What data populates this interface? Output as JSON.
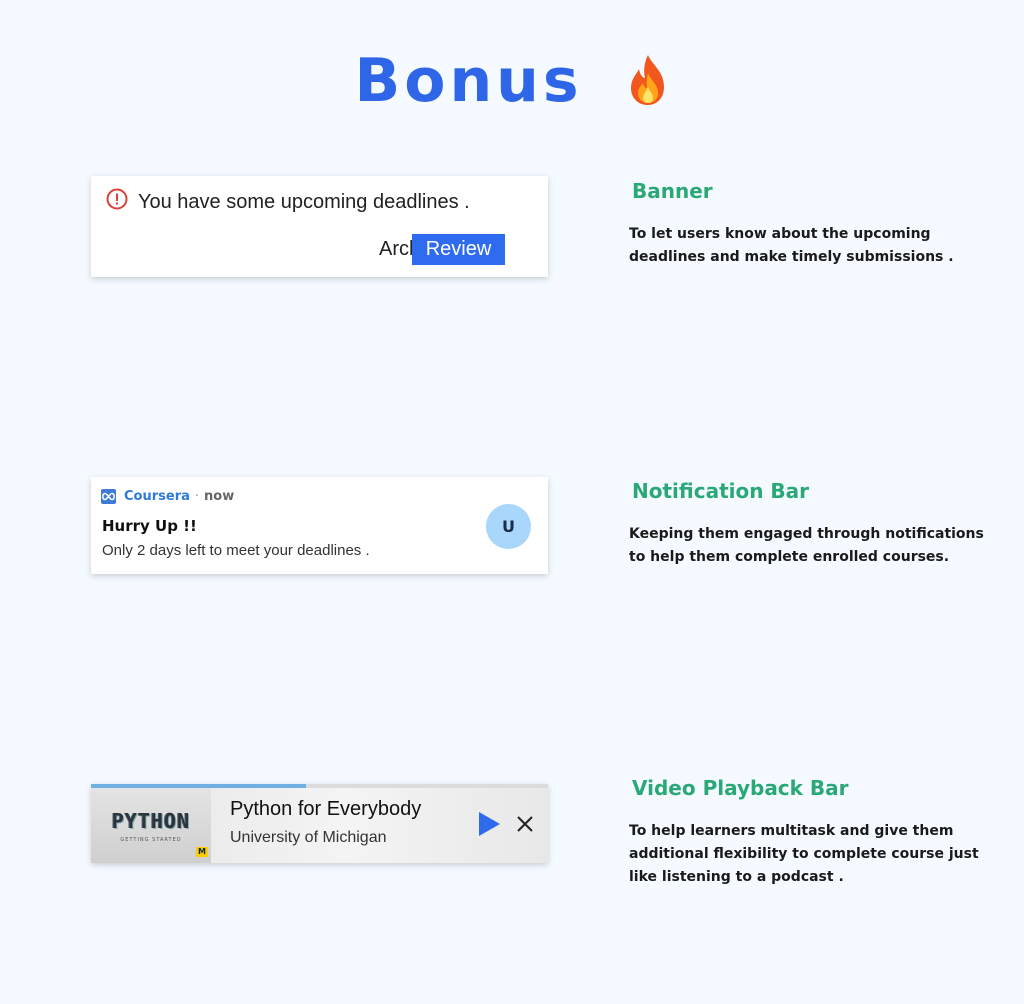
{
  "page": {
    "title": "Bonus",
    "accent": "#2f66e8",
    "heading_color": "#2aa876"
  },
  "banner": {
    "message": "You have some upcoming deadlines .",
    "archive_label": "Archive",
    "review_label": "Review",
    "icon": "alert-circle-icon",
    "icon_color": "#d9403a"
  },
  "notification": {
    "app_name": "Coursera",
    "separator": "·",
    "time": "now",
    "title": "Hurry Up !!",
    "body": "Only 2 days left to meet your deadlines .",
    "avatar_letter": "U",
    "icon": "coursera-infinity-icon"
  },
  "video_bar": {
    "progress": 0.47,
    "thumb_title": "PYTHON",
    "thumb_subtitle": "GETTING STARTED",
    "thumb_badge": "M",
    "title": "Python for Everybody",
    "subtitle": "University of Michigan",
    "play_icon": "play-icon",
    "close_icon": "close-icon",
    "play_color": "#2f6bef"
  },
  "sections": [
    {
      "heading": "Banner",
      "lines": [
        "To let users know about the upcoming",
        "deadlines and make timely submissions ."
      ]
    },
    {
      "heading": "Notification Bar",
      "lines": [
        "Keeping them engaged through notifications",
        "to help them complete enrolled courses."
      ]
    },
    {
      "heading": "Video Playback Bar",
      "lines": [
        "To help learners multitask and give them",
        "additional flexibility to complete course just",
        "like listening to a podcast ."
      ]
    }
  ]
}
